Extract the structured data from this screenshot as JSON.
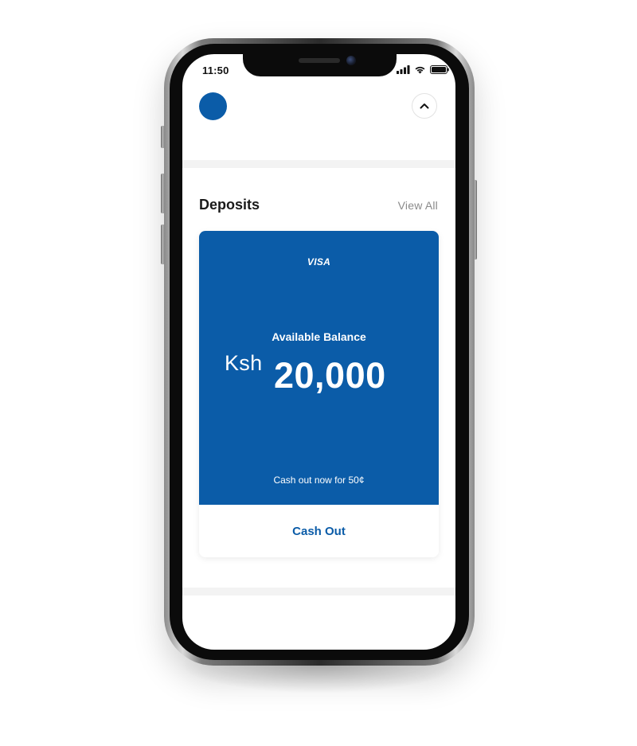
{
  "status_bar": {
    "time": "11:50",
    "icons": [
      "signal-icon",
      "wifi-icon",
      "battery-icon"
    ]
  },
  "header": {
    "collapse_icon": "chevron-up-icon"
  },
  "deposits": {
    "title": "Deposits",
    "view_all": "View All",
    "card": {
      "brand": "VISA",
      "balance_label": "Available Balance",
      "currency": "Ksh",
      "amount": "20,000",
      "note": "Cash out now for 50¢",
      "action": "Cash Out"
    }
  },
  "colors": {
    "brand_blue": "#0b5ca8",
    "background": "#ffffff",
    "muted_text": "#8a8a8a",
    "divider": "#f3f3f3"
  }
}
